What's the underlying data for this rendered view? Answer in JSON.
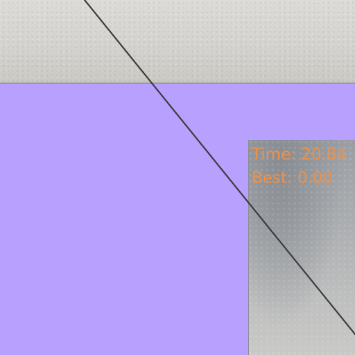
{
  "hud": {
    "time_text": "Time: 20.84",
    "best_text": "Best: 0.00"
  },
  "colors": {
    "playfield": "#b7a0fe",
    "hud_text": "#e8924f",
    "line": "#3c3c3c"
  }
}
